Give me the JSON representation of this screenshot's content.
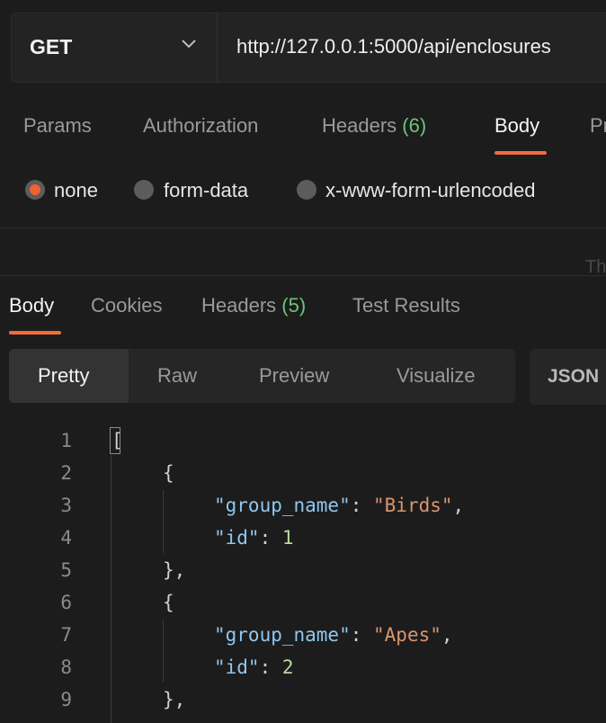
{
  "request": {
    "method": "GET",
    "url": "http://127.0.0.1:5000/api/enclosures"
  },
  "request_tabs": {
    "params": "Params",
    "authorization": "Authorization",
    "headers": "Headers",
    "headers_count": "(6)",
    "body": "Body",
    "pre": "Pr"
  },
  "body_modes": {
    "none": "none",
    "form_data": "form-data",
    "urlencoded": "x-www-form-urlencoded",
    "selected": "none"
  },
  "truncated_text": "Th",
  "response_tabs": {
    "body": "Body",
    "cookies": "Cookies",
    "headers": "Headers",
    "headers_count": "(5)",
    "test_results": "Test Results"
  },
  "view_modes": {
    "pretty": "Pretty",
    "raw": "Raw",
    "preview": "Preview",
    "visualize": "Visualize",
    "format": "JSON"
  },
  "code": {
    "line_numbers": [
      "1",
      "2",
      "3",
      "4",
      "5",
      "6",
      "7",
      "8",
      "9"
    ],
    "l1": "[",
    "l2": "{",
    "l3_key": "\"group_name\"",
    "l3_colon": ": ",
    "l3_val": "\"Birds\"",
    "l3_comma": ",",
    "l4_key": "\"id\"",
    "l4_colon": ": ",
    "l4_val": "1",
    "l5": "},",
    "l6": "{",
    "l7_key": "\"group_name\"",
    "l7_colon": ": ",
    "l7_val": "\"Apes\"",
    "l7_comma": ",",
    "l8_key": "\"id\"",
    "l8_colon": ": ",
    "l8_val": "2",
    "l9": "},"
  },
  "colors": {
    "accent": "#f26b3a",
    "count_green": "#6dc27a",
    "json_key": "#8fc7ee",
    "json_string": "#d8956e"
  },
  "icons": {
    "method_dropdown": "chevron-down-icon"
  }
}
